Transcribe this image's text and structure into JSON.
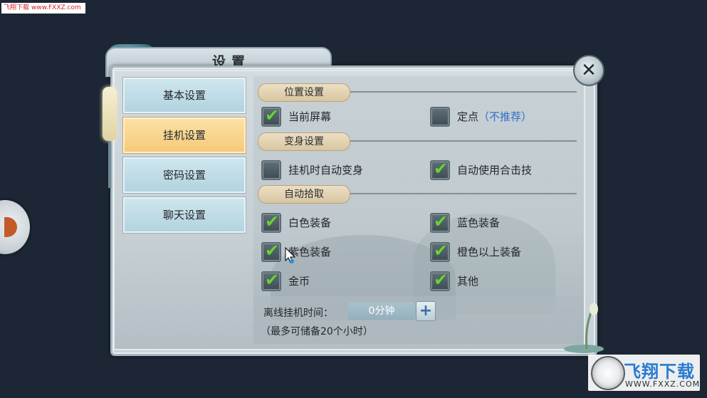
{
  "watermark_top": "飞翔下载 www.FXXZ.com",
  "dialog": {
    "title": "设置",
    "close_icon": "x-icon"
  },
  "tabs": [
    {
      "label": "基本设置",
      "active": false
    },
    {
      "label": "挂机设置",
      "active": true
    },
    {
      "label": "密码设置",
      "active": false
    },
    {
      "label": "聊天设置",
      "active": false
    }
  ],
  "sections": {
    "position": {
      "header": "位置设置",
      "items": [
        {
          "label": "当前屏幕",
          "checked": true
        },
        {
          "label": "定点",
          "note": "（不推荐）",
          "checked": false
        }
      ]
    },
    "transform": {
      "header": "变身设置",
      "items": [
        {
          "label": "挂机时自动变身",
          "checked": false
        },
        {
          "label": "自动使用合击技",
          "checked": true
        }
      ]
    },
    "pickup": {
      "header": "自动拾取",
      "items": [
        {
          "label": "白色装备",
          "checked": true
        },
        {
          "label": "蓝色装备",
          "checked": true
        },
        {
          "label": "紫色装备",
          "checked": true
        },
        {
          "label": "橙色以上装备",
          "checked": true
        },
        {
          "label": "金币",
          "checked": true
        },
        {
          "label": "其他",
          "checked": true
        }
      ]
    }
  },
  "offline": {
    "label": "离线挂机时间：",
    "value": "0分钟",
    "plus": "+",
    "note": "（最多可储备20个小时）"
  },
  "watermark_br": {
    "brand": "飞翔下载",
    "url": "WWW.FXXZ.COM"
  },
  "colors": {
    "check": "#6bd13b",
    "note": "#2f6fc4",
    "active_tab": "#f5c878",
    "tab": "#b0d3df"
  }
}
